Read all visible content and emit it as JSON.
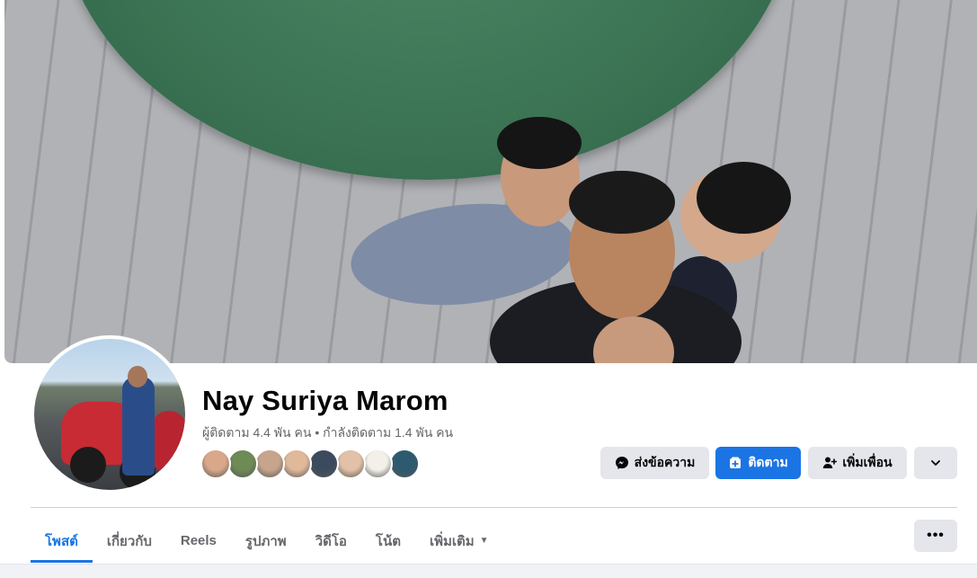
{
  "profile": {
    "name": "Nay Suriya Marom",
    "follow_info": "ผู้ติดตาม 4.4 พัน คน • กำลังติดตาม 1.4 พัน คน"
  },
  "friends": {
    "avatar_colors": [
      "#d9a88a",
      "#6e8a55",
      "#c7a58c",
      "#e0b89a",
      "#3c4a5e",
      "#e2c1a8",
      "#f3efe9",
      "#2e5a70"
    ]
  },
  "actions": {
    "message_label": "ส่งข้อความ",
    "follow_label": "ติดตาม",
    "add_friend_label": "เพิ่มเพื่อน"
  },
  "tabs": [
    {
      "label": "โพสต์",
      "active": true
    },
    {
      "label": "เกี่ยวกับ",
      "active": false
    },
    {
      "label": "Reels",
      "active": false
    },
    {
      "label": "รูปภาพ",
      "active": false
    },
    {
      "label": "วิดีโอ",
      "active": false
    },
    {
      "label": "โน้ต",
      "active": false
    },
    {
      "label": "เพิ่มเติม",
      "active": false
    }
  ],
  "colors": {
    "accent": "#1b74e4",
    "secondary_button": "#e4e6eb",
    "muted_text": "#65676b"
  },
  "icons": {
    "message": "messenger-icon",
    "follow": "follow-icon",
    "add_friend": "add-friend-icon",
    "more": "chevron-down-icon",
    "tab_more": "caret-down-icon",
    "tab_dots": "more-dots-icon"
  }
}
